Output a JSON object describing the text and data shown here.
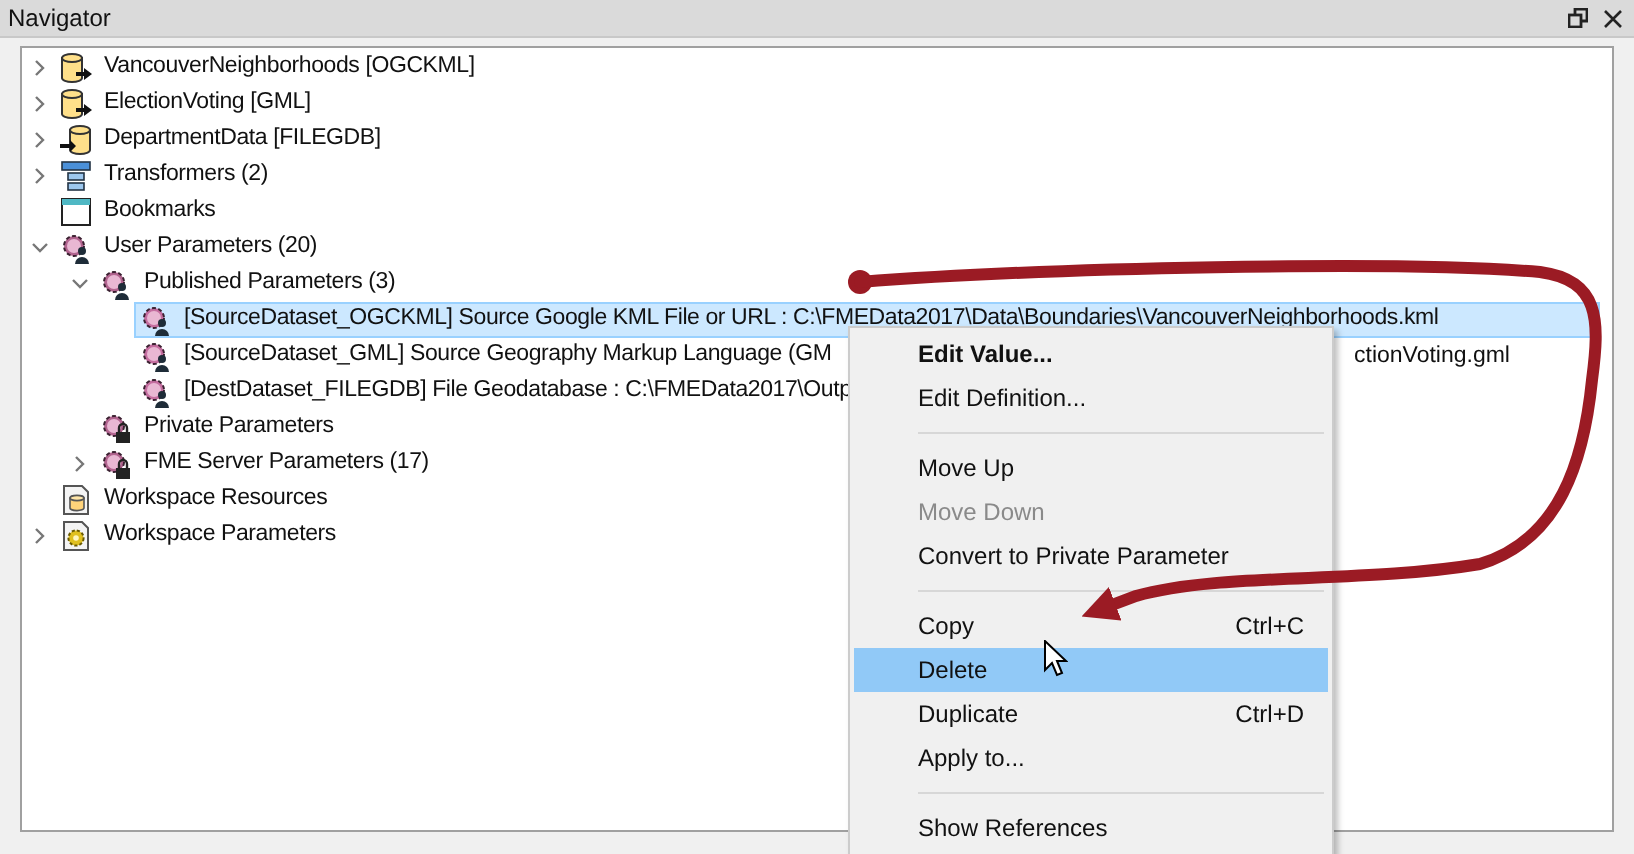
{
  "panel": {
    "title": "Navigator"
  },
  "tree": [
    {
      "label": "VancouverNeighborhoods [OGCKML]",
      "kind": "reader",
      "expanded": false
    },
    {
      "label": "ElectionVoting [GML]",
      "kind": "reader",
      "expanded": false
    },
    {
      "label": "DepartmentData [FILEGDB]",
      "kind": "writer",
      "expanded": false
    },
    {
      "label": "Transformers (2)",
      "kind": "transformers",
      "expanded": false
    },
    {
      "label": "Bookmarks",
      "kind": "bookmarks"
    },
    {
      "label": "User Parameters (20)",
      "kind": "user_params",
      "expanded": true,
      "children": [
        {
          "label": "Published Parameters (3)",
          "kind": "user_params",
          "expanded": true,
          "children": [
            {
              "label": "[SourceDataset_OGCKML] Source Google KML File or URL : C:\\FMEData2017\\Data\\Boundaries\\VancouverNeighborhoods.kml",
              "kind": "parameter",
              "selected": true
            },
            {
              "label": "[SourceDataset_GML] Source Geography Markup Language (GM",
              "label_after_menu": "ctionVoting.gml",
              "kind": "parameter",
              "selected": false
            },
            {
              "label": "[DestDataset_FILEGDB] File Geodatabase : C:\\FMEData2017\\Outp",
              "kind": "parameter",
              "selected": false
            }
          ]
        },
        {
          "label": "Private Parameters",
          "kind": "locked_params"
        },
        {
          "label": "FME Server Parameters (17)",
          "kind": "locked_params",
          "expanded": false
        }
      ]
    },
    {
      "label": "Workspace Resources",
      "kind": "resources"
    },
    {
      "label": "Workspace Parameters",
      "kind": "workspace_params",
      "expanded": false
    }
  ],
  "context_menu": [
    {
      "kind": "item",
      "label": "Edit Value...",
      "default": true,
      "disabled": false,
      "selected": false
    },
    {
      "kind": "item",
      "label": "Edit Definition...",
      "default": false,
      "disabled": false,
      "selected": false
    },
    {
      "kind": "separator"
    },
    {
      "kind": "item",
      "label": "Move Up",
      "default": false,
      "disabled": false,
      "selected": false
    },
    {
      "kind": "item",
      "label": "Move Down",
      "default": false,
      "disabled": true,
      "selected": false
    },
    {
      "kind": "item",
      "label": "Convert to Private Parameter",
      "default": false,
      "disabled": false,
      "selected": false
    },
    {
      "kind": "separator"
    },
    {
      "kind": "item",
      "label": "Copy",
      "shortcut": "Ctrl+C",
      "default": false,
      "disabled": false,
      "selected": false
    },
    {
      "kind": "item",
      "label": "Delete",
      "default": false,
      "disabled": false,
      "selected": true
    },
    {
      "kind": "item",
      "label": "Duplicate",
      "shortcut": "Ctrl+D",
      "default": false,
      "disabled": false,
      "selected": false
    },
    {
      "kind": "item",
      "label": "Apply to...",
      "default": false,
      "disabled": false,
      "selected": false
    },
    {
      "kind": "separator"
    },
    {
      "kind": "item",
      "label": "Show References",
      "default": false,
      "disabled": false,
      "selected": false
    }
  ]
}
